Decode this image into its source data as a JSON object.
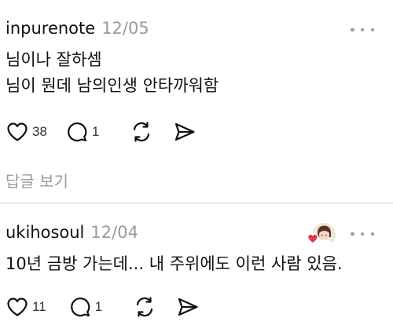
{
  "comments": [
    {
      "username": "inpurenote",
      "date": "12/05",
      "lines": [
        "님이나 잘하셈",
        "님이 뭔데 남의인생 안타까워함"
      ],
      "likes": "38",
      "replies_count": "1",
      "view_replies_label": "답글 보기",
      "icons": [
        "heart-outline-icon",
        "speech-bubble-icon",
        "repost-icon",
        "share-send-icon",
        "more-dots-icon"
      ]
    },
    {
      "username": "ukihosoul",
      "date": "12/04",
      "lines": [
        "10년 금방 가는데... 내 주위에도 이런 사람 있음."
      ],
      "likes": "11",
      "replies_count": "1",
      "has_avatar": true,
      "icons": [
        "heart-outline-icon",
        "speech-bubble-icon",
        "repost-icon",
        "share-send-icon",
        "more-dots-icon",
        "heart-badge-icon"
      ]
    }
  ],
  "colors": {
    "text": "#111111",
    "muted": "#9a9a9a",
    "badge": "#e53945",
    "divider": "#f0f0f0"
  }
}
